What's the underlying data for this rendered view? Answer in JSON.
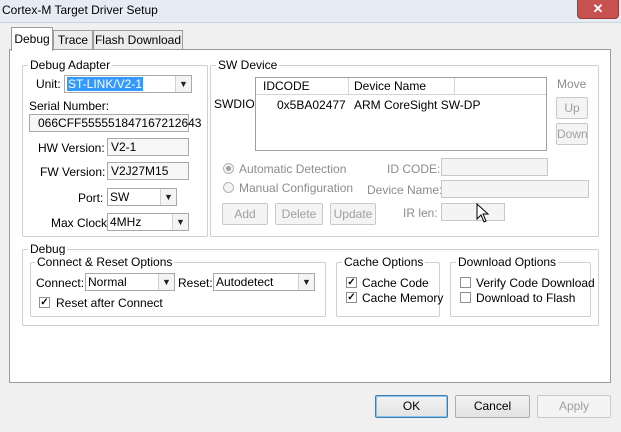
{
  "window": {
    "title": "Cortex-M Target Driver Setup",
    "close_glyph": "✕"
  },
  "tabs": [
    {
      "label": "Debug"
    },
    {
      "label": "Trace"
    },
    {
      "label": "Flash Download"
    }
  ],
  "debug_adapter": {
    "title": "Debug Adapter",
    "unit_label": "Unit:",
    "unit_value": "ST-LINK/V2-1",
    "serial_label": "Serial Number:",
    "serial_value": "066CFF555551847167212643",
    "hw_label": "HW Version:",
    "hw_value": "V2-1",
    "fw_label": "FW Version:",
    "fw_value": "V2J27M15",
    "port_label": "Port:",
    "port_value": "SW",
    "clock_label": "Max Clock:",
    "clock_value": "4MHz"
  },
  "sw_device": {
    "title": "SW Device",
    "row_label": "SWDIO",
    "columns": [
      "IDCODE",
      "Device Name"
    ],
    "rows": [
      {
        "idcode": "0x5BA02477",
        "name": "ARM CoreSight SW-DP"
      }
    ],
    "move_label": "Move",
    "up_label": "Up",
    "down_label": "Down",
    "auto_label": "Automatic Detection",
    "manual_label": "Manual Configuration",
    "idcode_label": "ID CODE:",
    "devname_label": "Device Name:",
    "irlen_label": "IR len:",
    "add_label": "Add",
    "delete_label": "Delete",
    "update_label": "Update"
  },
  "debug": {
    "title": "Debug",
    "connect_reset": {
      "title": "Connect & Reset Options",
      "connect_label": "Connect:",
      "connect_value": "Normal",
      "reset_label": "Reset:",
      "reset_value": "Autodetect",
      "reset_after_label": "Reset after Connect",
      "reset_after_checked": true
    },
    "cache": {
      "title": "Cache Options",
      "code_label": "Cache Code",
      "code_checked": true,
      "memory_label": "Cache Memory",
      "memory_checked": true
    },
    "download": {
      "title": "Download Options",
      "verify_label": "Verify Code Download",
      "verify_checked": false,
      "flash_label": "Download to Flash",
      "flash_checked": false
    }
  },
  "footer": {
    "ok_label": "OK",
    "cancel_label": "Cancel",
    "apply_label": "Apply"
  },
  "check_glyph": "✓",
  "arrow_glyph": "▼"
}
